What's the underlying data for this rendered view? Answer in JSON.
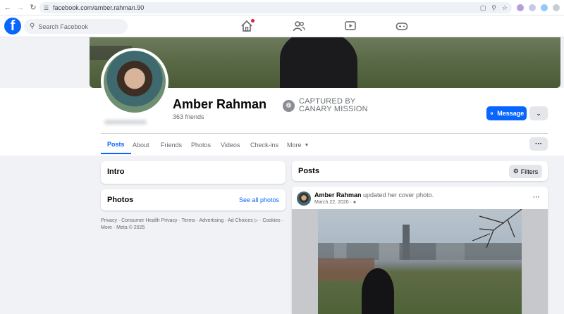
{
  "browser": {
    "url": "facebook.com/amber.rahman.90"
  },
  "fb": {
    "search_placeholder": "Search Facebook"
  },
  "profile": {
    "name": "Amber Rahman",
    "friends": "363 friends",
    "message_label": "Message"
  },
  "watermark": {
    "line1": "CAPTURED BY",
    "line2": "CANARY MISSION"
  },
  "tabs": [
    {
      "label": "Posts"
    },
    {
      "label": "About"
    },
    {
      "label": "Friends"
    },
    {
      "label": "Photos"
    },
    {
      "label": "Videos"
    },
    {
      "label": "Check-ins"
    },
    {
      "label": "More"
    }
  ],
  "intro": {
    "title": "Intro"
  },
  "photos": {
    "title": "Photos",
    "see_all": "See all photos"
  },
  "footer": {
    "text": "Privacy · Consumer Health Privacy · Terms · Advertising · Ad Choices ▷ · Cookies · More · Meta © 2025"
  },
  "posts": {
    "title": "Posts",
    "filters_label": "Filters",
    "post": {
      "author": "Amber Rahman",
      "action": " updated her cover photo.",
      "date": "March 22, 2020 ·"
    }
  },
  "colors": {
    "brand_blue": "#0866ff",
    "background": "#f0f2f5",
    "secondary_text": "#65676b"
  }
}
